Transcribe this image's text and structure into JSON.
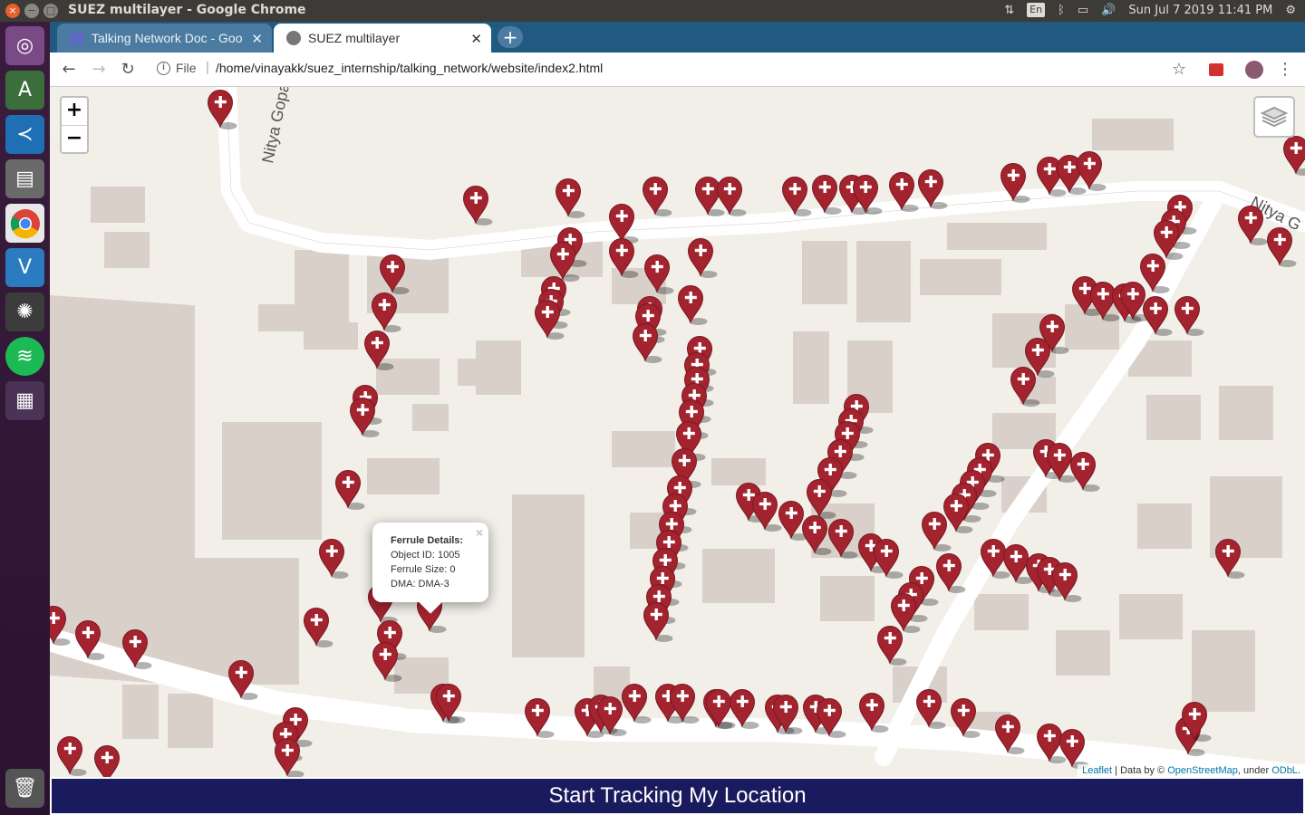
{
  "window_title": "SUEZ multilayer - Google Chrome",
  "topbar": {
    "lang": "En",
    "datetime": "Sun Jul 7 2019 11:41 PM"
  },
  "tabs": [
    {
      "label": "Talking Network Doc - Goo",
      "icon": "docs-icon",
      "active": false
    },
    {
      "label": "SUEZ multilayer",
      "icon": "globe-icon",
      "active": true
    }
  ],
  "address": {
    "scheme_label": "File",
    "url": "/home/vinayakk/suez_internship/talking_network/website/index2.html"
  },
  "map": {
    "street_labels": [
      "Nitya Gopa",
      "Nitya G"
    ],
    "zoom_in": "+",
    "zoom_out": "−",
    "popup": {
      "title": "Ferrule Details:",
      "object_id": "Object ID: 1005",
      "ferrule_size": "Ferrule Size: 0",
      "dma": "DMA: DMA-3",
      "close": "×"
    },
    "attribution": {
      "leaflet": "Leaflet",
      "data_by": " | Data by © ",
      "osm": "OpenStreetMap",
      "under": ", under ",
      "odbl": "ODbL",
      "end": "."
    },
    "marker_color": "#a3232f"
  },
  "track_button": "Start Tracking My Location",
  "colors": {
    "tab_strip": "#215a80",
    "track_button": "#1a1a5e",
    "map_background": "#f2efe9",
    "road": "#ffffff",
    "building": "#d9d0c9"
  }
}
